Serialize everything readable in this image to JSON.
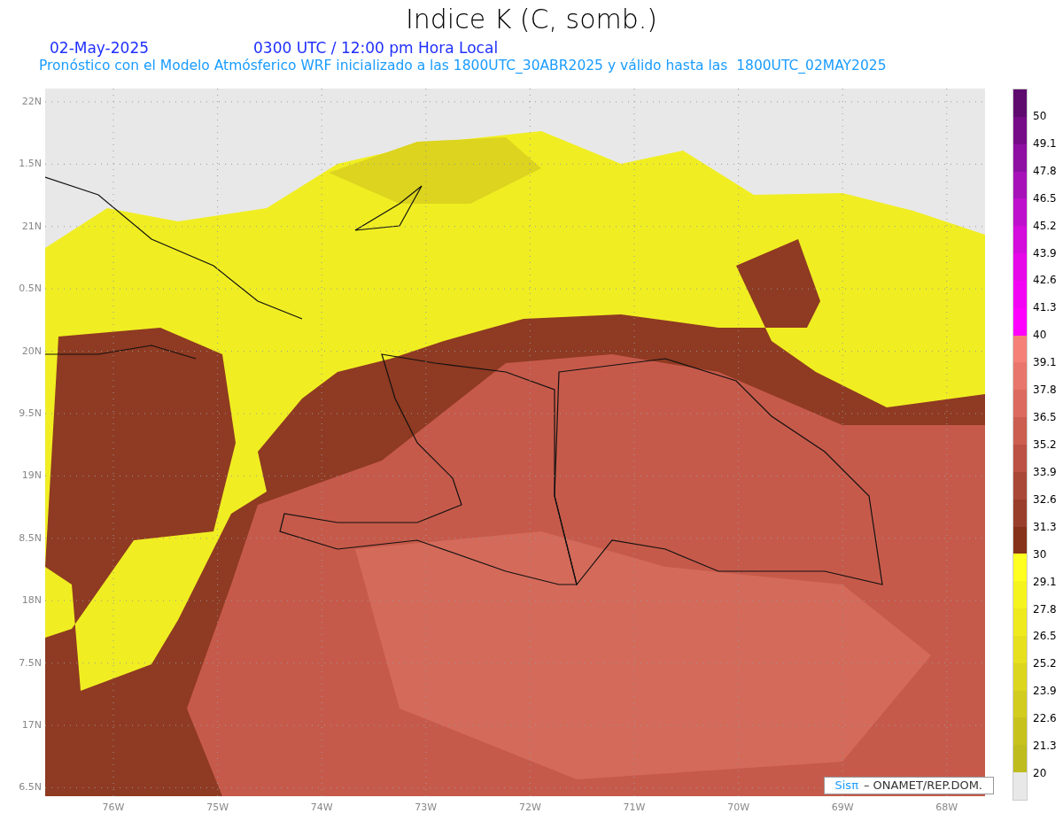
{
  "title": "Indice K (C, somb.)",
  "date": "02-May-2025",
  "time": "0300 UTC / 12:00 pm Hora Local",
  "forecast": "Pronóstico con el Modelo Atmósferico WRF inicializado a las 1800UTC_30ABR2025 y válido hasta las  1800UTC_02MAY2025",
  "y_labels": [
    "22N",
    "1.5N",
    "21N",
    "0.5N",
    "20N",
    "9.5N",
    "19N",
    "8.5N",
    "18N",
    "7.5N",
    "17N",
    "6.5N"
  ],
  "x_labels": [
    "76W",
    "75W",
    "74W",
    "73W",
    "72W",
    "71W",
    "70W",
    "69W",
    "68W"
  ],
  "credit": {
    "brand": "Sisπ",
    "text": "–  ONAMET/REP.DOM."
  },
  "legend": [
    {
      "color": "#5e0a6e",
      "label": "50"
    },
    {
      "color": "#760c88",
      "label": "49.1"
    },
    {
      "color": "#8e10a2",
      "label": "47.8"
    },
    {
      "color": "#a612b8",
      "label": "46.5"
    },
    {
      "color": "#be10cc",
      "label": "45.2"
    },
    {
      "color": "#d40cdc",
      "label": "43.9"
    },
    {
      "color": "#e608e8",
      "label": "42.6"
    },
    {
      "color": "#f404f4",
      "label": "41.3"
    },
    {
      "color": "#ff00ff",
      "label": "40"
    },
    {
      "color": "#f48078",
      "label": "39.1"
    },
    {
      "color": "#e8766c",
      "label": "37.8"
    },
    {
      "color": "#dc6a5e",
      "label": "36.5"
    },
    {
      "color": "#cc5e50",
      "label": "35.2"
    },
    {
      "color": "#bc5244",
      "label": "33.9"
    },
    {
      "color": "#aa4838",
      "label": "32.6"
    },
    {
      "color": "#9a3e2c",
      "label": "31.3"
    },
    {
      "color": "#86321a",
      "label": "30"
    },
    {
      "color": "#ffff20",
      "label": "29.1"
    },
    {
      "color": "#f6f41e",
      "label": "27.8"
    },
    {
      "color": "#eeea1e",
      "label": "26.5"
    },
    {
      "color": "#e6e01e",
      "label": "25.2"
    },
    {
      "color": "#dcd61e",
      "label": "23.9"
    },
    {
      "color": "#d2cc1e",
      "label": "22.6"
    },
    {
      "color": "#c8c21e",
      "label": "21.3"
    },
    {
      "color": "#bebc1e",
      "label": "20"
    },
    {
      "color": "#e8e8e8"
    }
  ]
}
